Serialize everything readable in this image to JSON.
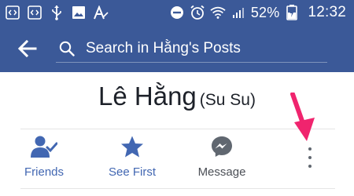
{
  "status_bar": {
    "battery_percent": "52%",
    "time": "12:32",
    "left_icons": [
      "code-icon",
      "code-icon",
      "usb-icon",
      "image-icon",
      "text-a-icon"
    ],
    "right_icons": [
      "do-not-disturb-icon",
      "alarm-icon",
      "wifi-icon",
      "signal-icon",
      "battery-charging-icon"
    ]
  },
  "header": {
    "search_placeholder": "Search in Hằng's Posts",
    "color": "#3b5998"
  },
  "profile": {
    "name": "Lê Hằng",
    "nickname": "(Su Su)"
  },
  "actions": [
    {
      "label": "Friends",
      "icon": "friends-check-icon",
      "color": "#4267b2"
    },
    {
      "label": "See First",
      "icon": "star-icon",
      "color": "#4267b2"
    },
    {
      "label": "Message",
      "icon": "messenger-icon",
      "color": "#4b4f56"
    }
  ],
  "more_icon": "more-vertical-icon",
  "annotation_color": "#f0246e"
}
